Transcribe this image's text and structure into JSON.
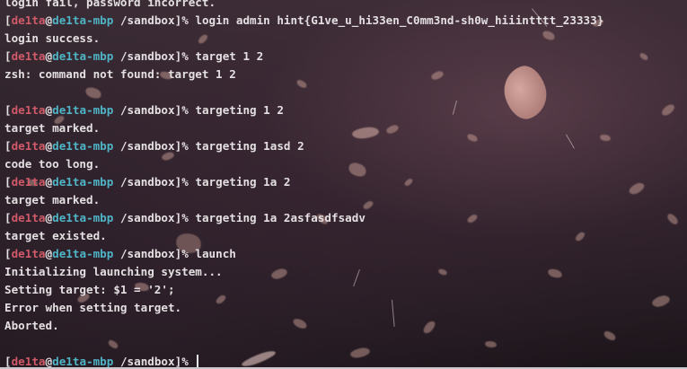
{
  "prompt": {
    "open_bracket": "[",
    "user": "de1ta",
    "at": "@",
    "host": "de1ta-mbp",
    "path": " /sandbox",
    "close": "]%"
  },
  "lines": [
    {
      "type": "output",
      "text": "login fail, password incorrect."
    },
    {
      "type": "cmd",
      "text": " login admin hint{G1ve_u_hi33en_C0mm3nd-sh0w_hiiintttt_23333}"
    },
    {
      "type": "output",
      "text": "login success."
    },
    {
      "type": "cmd",
      "text": " target 1 2"
    },
    {
      "type": "output",
      "text": "zsh: command not found: target 1 2"
    },
    {
      "type": "output",
      "text": ""
    },
    {
      "type": "cmd",
      "text": " targeting 1 2"
    },
    {
      "type": "output",
      "text": "target marked."
    },
    {
      "type": "cmd",
      "text": " targeting 1asd 2"
    },
    {
      "type": "output",
      "text": "code too long."
    },
    {
      "type": "cmd",
      "text": " targeting 1a 2"
    },
    {
      "type": "output",
      "text": "target marked."
    },
    {
      "type": "cmd",
      "text": " targeting 1a 2asfasdfsadv"
    },
    {
      "type": "output",
      "text": "target existed."
    },
    {
      "type": "cmd",
      "text": " launch"
    },
    {
      "type": "output",
      "text": "Initializing launching system..."
    },
    {
      "type": "output",
      "text": "Setting target: $1 = '2';"
    },
    {
      "type": "output",
      "text": "Error when setting target."
    },
    {
      "type": "output",
      "text": "Aborted."
    },
    {
      "type": "output",
      "text": ""
    },
    {
      "type": "cmd",
      "text": " "
    }
  ],
  "colors": {
    "user": "#d05a68",
    "host": "#4fb4c6",
    "text": "#e4e0e2"
  }
}
